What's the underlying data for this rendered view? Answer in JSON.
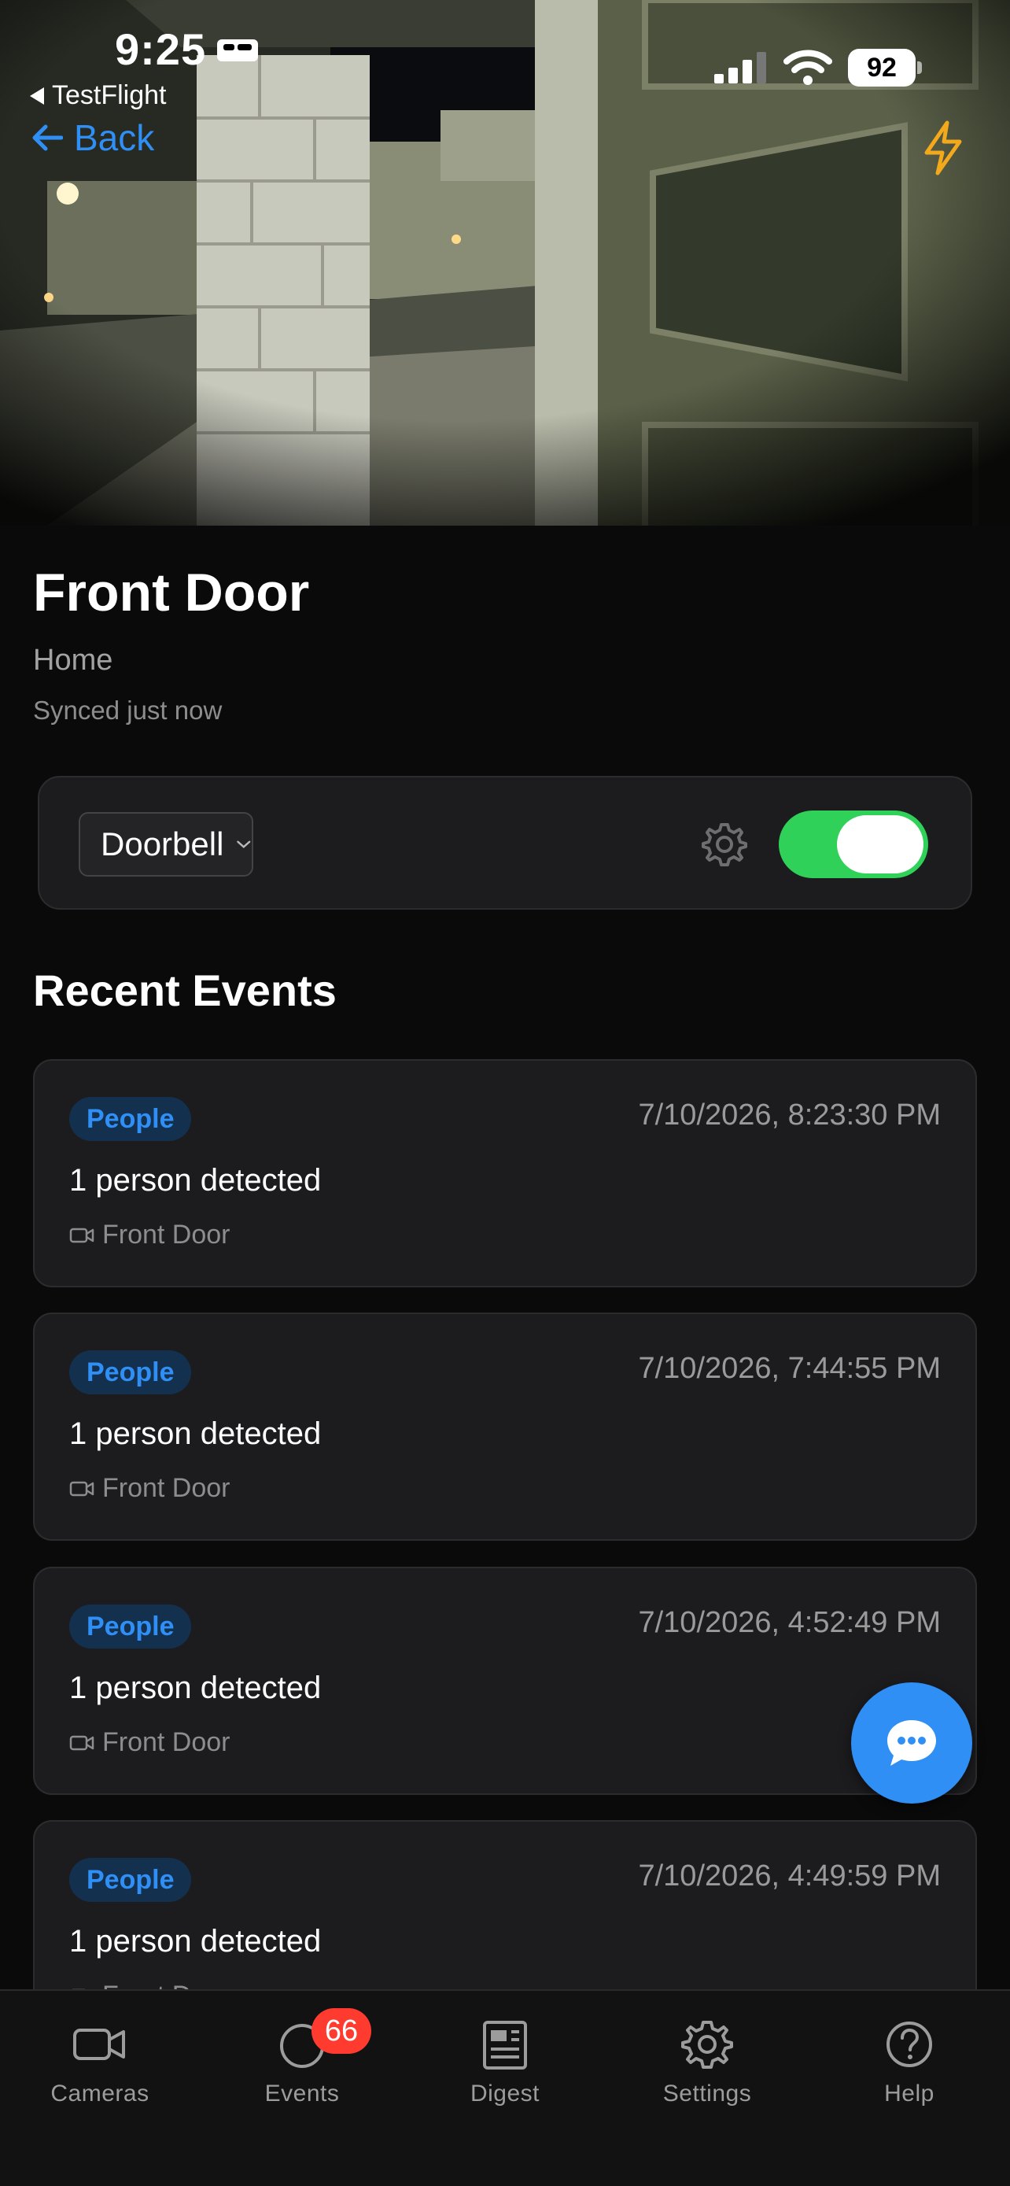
{
  "status_bar": {
    "time": "9:25",
    "back_app": "TestFlight",
    "battery": "92"
  },
  "nav": {
    "back_label": "Back"
  },
  "camera": {
    "name": "Front Door",
    "location": "Home",
    "sync_status": "Synced just now",
    "mode_select": {
      "selected": "Doorbell"
    },
    "enabled": true
  },
  "recent_events": {
    "title": "Recent Events",
    "items": [
      {
        "tag": "People",
        "timestamp": "7/10/2026, 8:23:30 PM",
        "description": "1 person detected",
        "camera": "Front Door"
      },
      {
        "tag": "People",
        "timestamp": "7/10/2026, 7:44:55 PM",
        "description": "1 person detected",
        "camera": "Front Door"
      },
      {
        "tag": "People",
        "timestamp": "7/10/2026, 4:52:49 PM",
        "description": "1 person detected",
        "camera": "Front Door"
      },
      {
        "tag": "People",
        "timestamp": "7/10/2026, 4:49:59 PM",
        "description": "1 person detected",
        "camera": "Front Door"
      }
    ]
  },
  "tab_bar": {
    "items": [
      {
        "label": "Cameras",
        "icon": "video-camera-icon"
      },
      {
        "label": "Events",
        "icon": "circle-icon",
        "badge": "66"
      },
      {
        "label": "Digest",
        "icon": "newspaper-icon"
      },
      {
        "label": "Settings",
        "icon": "gear-icon"
      },
      {
        "label": "Help",
        "icon": "question-circle-icon"
      }
    ]
  },
  "colors": {
    "accent": "#2f8ff5",
    "toggle_on": "#30d158",
    "badge": "#ff3b30",
    "flash": "#f2a91c"
  }
}
